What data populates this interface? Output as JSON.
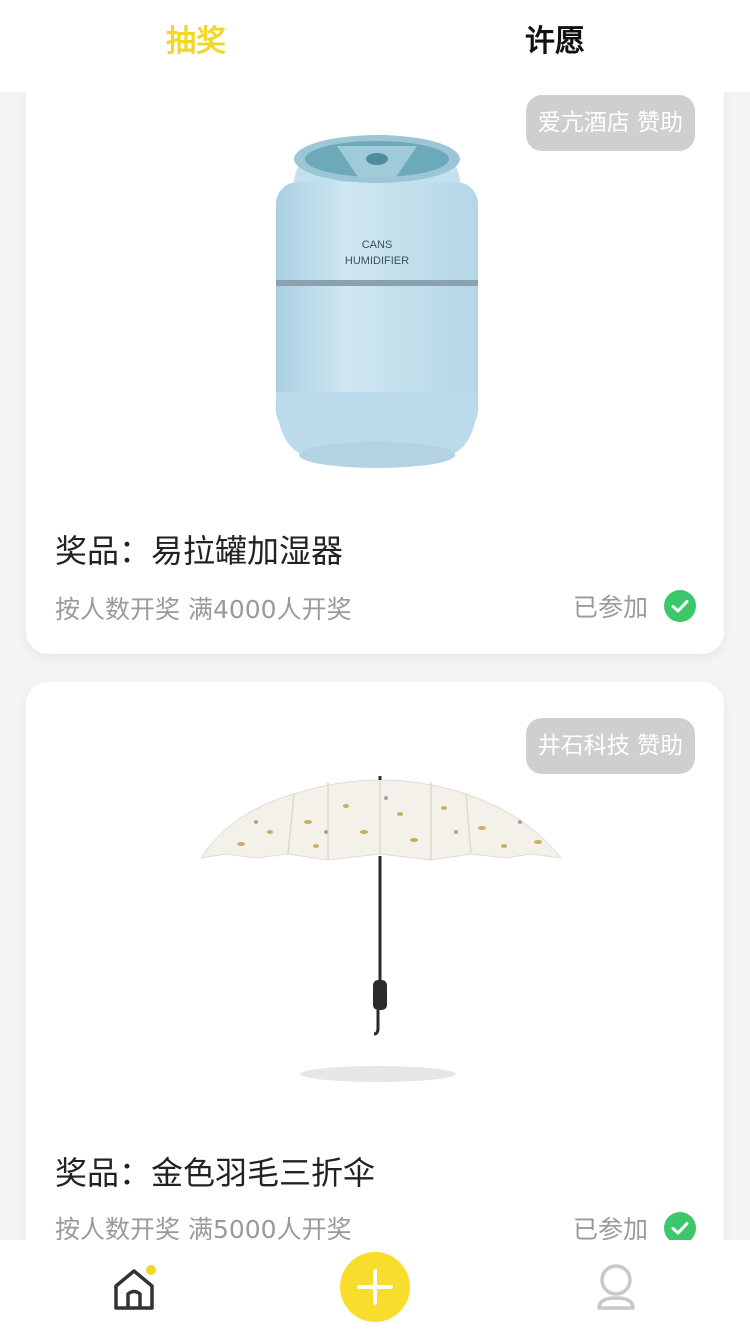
{
  "tabs": [
    {
      "label": "抽奖",
      "active": true
    },
    {
      "label": "许愿",
      "active": false
    }
  ],
  "colors": {
    "accent": "#f1d72a",
    "joined_check": "#3cc86a",
    "sponsor_badge": "#cfcfcf"
  },
  "prizes": [
    {
      "sponsor": "爱亢酒店 赞助",
      "title": "奖品：易拉罐加湿器",
      "rule": "按人数开奖 满4000人开奖",
      "status": "已参加",
      "image_text": [
        "CANS",
        "HUMIDIFIER"
      ]
    },
    {
      "sponsor": "井石科技 赞助",
      "title": "奖品：金色羽毛三折伞",
      "rule": "按人数开奖 满5000人开奖",
      "status": "已参加"
    }
  ],
  "bottom_nav": [
    {
      "icon": "home-icon"
    },
    {
      "icon": "plus-icon"
    },
    {
      "icon": "user-icon"
    }
  ]
}
